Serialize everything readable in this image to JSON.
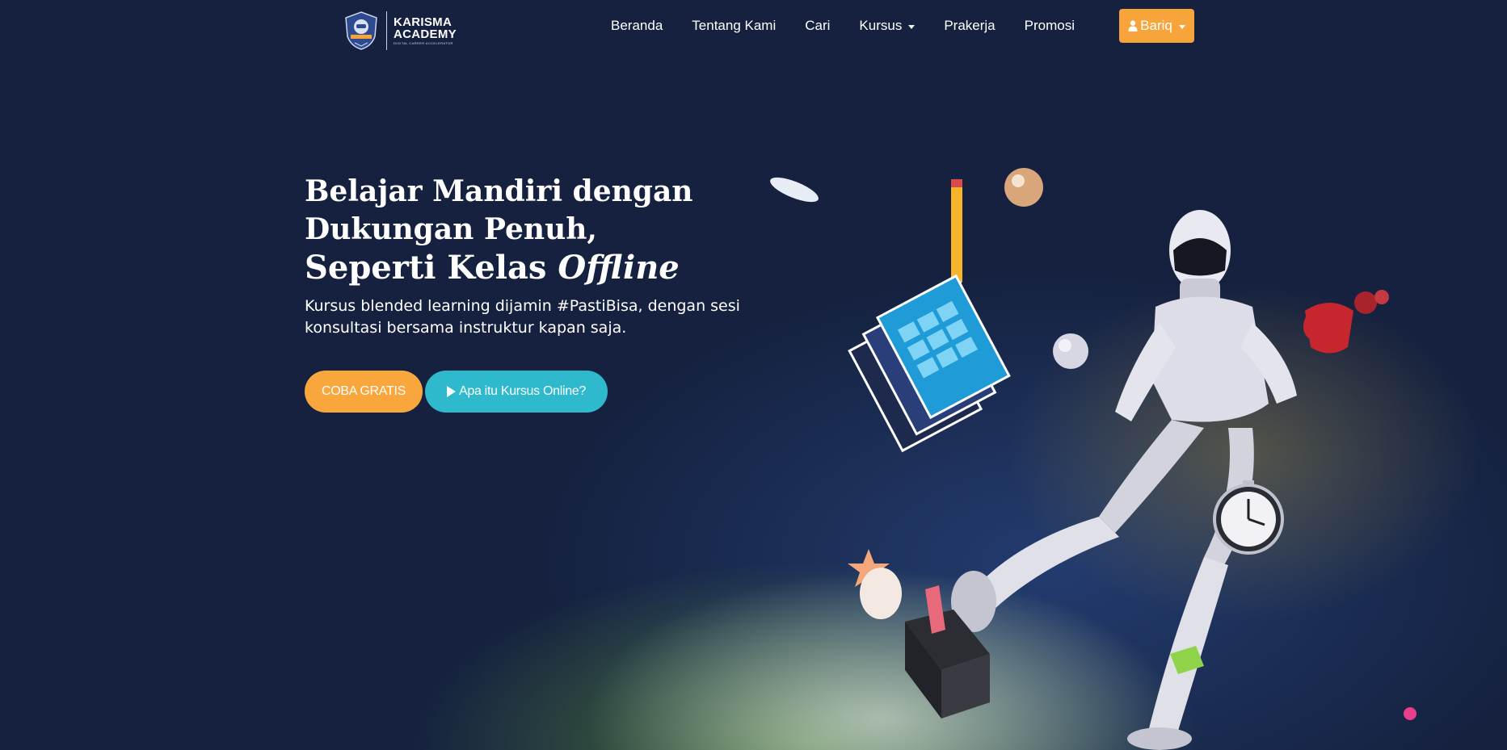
{
  "brand": {
    "name": "KARISMA\nACADEMY",
    "name_line1": "KARISMA",
    "name_line2": "ACADEMY",
    "tagline": "DIGITAL CAREER ACCELERATOR"
  },
  "nav": {
    "items": [
      {
        "label": "Beranda"
      },
      {
        "label": "Tentang Kami"
      },
      {
        "label": "Cari"
      },
      {
        "label": "Kursus",
        "dropdown": true
      },
      {
        "label": "Prakerja"
      },
      {
        "label": "Promosi"
      }
    ],
    "user": {
      "label": "Bariq",
      "icon": "user-icon"
    }
  },
  "hero": {
    "title_line1": "Belajar Mandiri dengan",
    "title_line2": "Dukungan Penuh,",
    "title_line3_prefix": "Seperti Kelas ",
    "title_line3_emphasis": "Offline",
    "description": "Kursus blended learning dijamin #PastiBisa, dengan sesi konsultasi bersama instruktur kapan saja.",
    "primary_button": "COBA GRATIS",
    "secondary_button": "Apa itu Kursus Online?"
  },
  "colors": {
    "background": "#15213f",
    "accent_orange": "#f9a73c",
    "accent_teal": "#2eb9cd"
  }
}
